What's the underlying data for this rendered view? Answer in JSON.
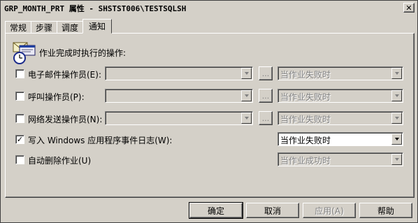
{
  "window": {
    "title": "GRP_MONTH_PRT 属性 - SHSTST006\\TESTSQLSH",
    "close_glyph": "✕"
  },
  "tabs": [
    {
      "label": "常规",
      "active": false
    },
    {
      "label": "步骤",
      "active": false
    },
    {
      "label": "调度",
      "active": false
    },
    {
      "label": "通知",
      "active": true
    }
  ],
  "notify": {
    "header_icon": "envelope-clock-icon",
    "header_label": "作业完成时执行的操作:",
    "rows": [
      {
        "label": "电子邮件操作员(E):",
        "checked": false,
        "target_value": "",
        "dots": "...",
        "when_value": "当作业失败时"
      },
      {
        "label": "呼叫操作员(P):",
        "checked": false,
        "target_value": "",
        "dots": "...",
        "when_value": "当作业失败时"
      },
      {
        "label": "网络发送操作员(N):",
        "checked": false,
        "target_value": "",
        "dots": "...",
        "when_value": "当作业失败时"
      },
      {
        "label": "写入 Windows 应用程序事件日志(W):",
        "checked": true,
        "when_value": "当作业失败时"
      },
      {
        "label": "自动删除作业(U)",
        "checked": false,
        "when_value": "当作业成功时"
      }
    ],
    "check_glyph": "✓"
  },
  "buttons": {
    "ok": "确定",
    "cancel": "取消",
    "apply": "应用(A)",
    "help": "帮助"
  }
}
